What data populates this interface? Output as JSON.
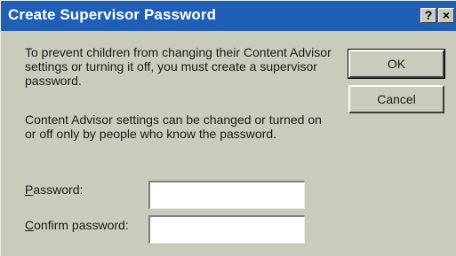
{
  "dialog": {
    "title": "Create Supervisor Password",
    "help_button": "?",
    "close_button": "×",
    "message_1": "To prevent children from changing their Content Advisor settings or turning it off, you must create a supervisor password.",
    "message_2": "Content Advisor settings can be changed or turned on or off only by people who know the password.",
    "password_label_accel": "P",
    "password_label_rest": "assword:",
    "confirm_label_accel": "C",
    "confirm_label_rest": "onfirm password:",
    "password_value": "",
    "confirm_value": "",
    "ok_label": "OK",
    "cancel_label": "Cancel"
  },
  "colors": {
    "titlebar": "#1f5fb5",
    "face": "#c9ccbd",
    "title_text": "#ffffff"
  },
  "icons": {
    "help": "question-mark",
    "close": "x-mark"
  }
}
